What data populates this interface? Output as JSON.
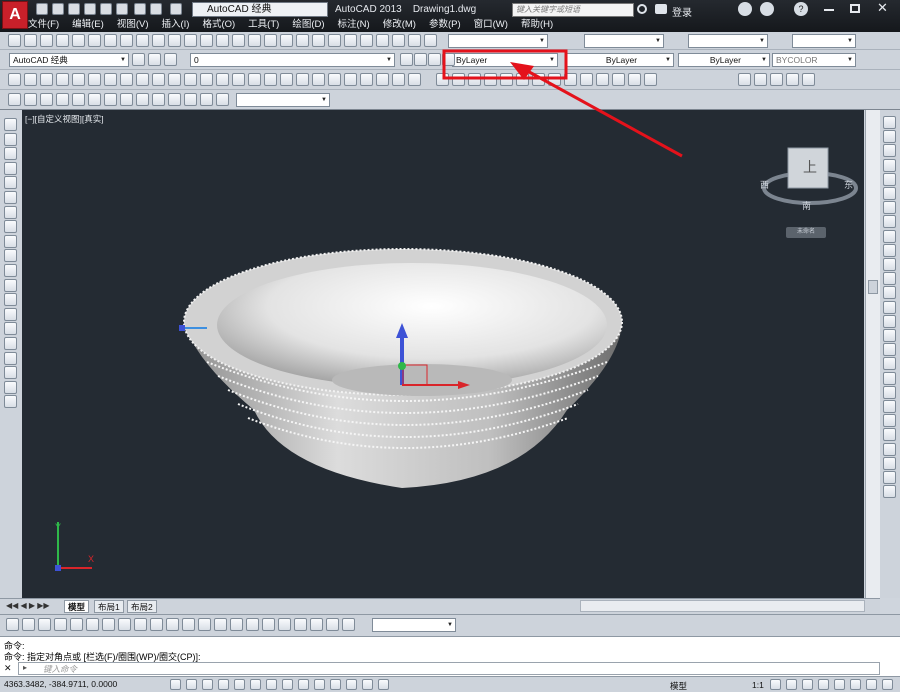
{
  "app": {
    "logo_letter": "A"
  },
  "titlebar": {
    "workspace_selected": "AutoCAD 经典",
    "document_title": "AutoCAD 2013    Drawing1.dwg",
    "search_placeholder": "键入关键字或短语",
    "login_label": "登录",
    "help_icon": "?"
  },
  "menubar": {
    "items": [
      "文件(F)",
      "编辑(E)",
      "视图(V)",
      "插入(I)",
      "格式(O)",
      "工具(T)",
      "绘图(D)",
      "标注(N)",
      "修改(M)",
      "参数(P)",
      "窗口(W)",
      "帮助(H)"
    ]
  },
  "toolbar2": {
    "workspace_dropdown": "AutoCAD 经典",
    "layer_dropdown": "0",
    "color_dropdown": "ByLayer",
    "linetype_dropdown": "ByLayer",
    "lineweight_dropdown": "ByLayer",
    "plotstyle_dropdown": "BYCOLOR"
  },
  "viewport": {
    "label": "[−][自定义视图][真实]",
    "viewcube_face": "上",
    "viewcube_north": "南",
    "viewcube_west": "西",
    "viewcube_east": "东",
    "ucs_menu": "未命名"
  },
  "layout_tabs": [
    "模型",
    "布局1",
    "布局2"
  ],
  "command": {
    "history": [
      "命令:",
      "命令: 指定对角点或 [栏选(F)/圈围(WP)/圈交(CP)]:"
    ],
    "input_placeholder": "键入命令"
  },
  "status": {
    "coordinates": "4363.3482, -384.9711, 0.0000",
    "model_label": "模型",
    "scale_label": "1:1"
  },
  "colors": {
    "annotation_red": "#e4121b",
    "viewport_bg": "#242b33",
    "x_axis": "#d9252a",
    "y_axis": "#2fb84a",
    "z_axis": "#3d52d6"
  }
}
